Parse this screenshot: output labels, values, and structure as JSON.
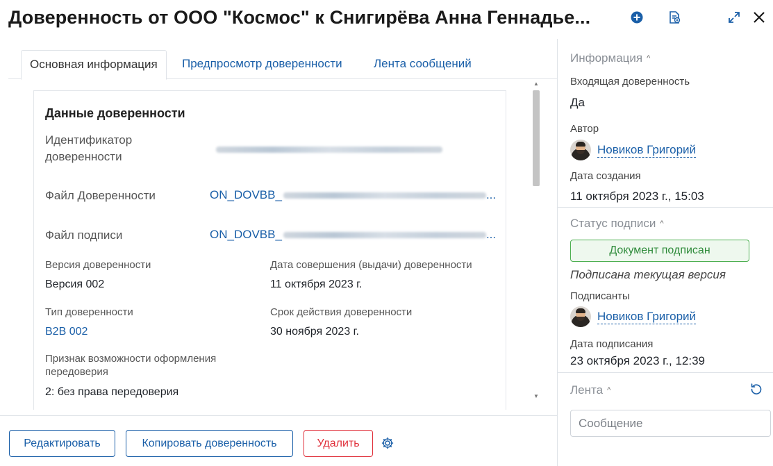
{
  "header": {
    "title": "Доверенность от ООО \"Космос\" к Снигирёва Анна Геннадье...",
    "icons": [
      "plus-circle-icon",
      "document-sign-icon",
      "expand-icon",
      "close-icon"
    ]
  },
  "tabs": [
    {
      "label": "Основная информация",
      "active": true
    },
    {
      "label": "Предпросмотр доверенности",
      "active": false
    },
    {
      "label": "Лента сообщений",
      "active": false
    }
  ],
  "content": {
    "section_title": "Данные доверенности",
    "identifier_label": "Идентификатор\nдоверенности",
    "file_label": "Файл Доверенности",
    "file_value": "ON_DOVBB_",
    "file_ellipsis": "...",
    "sign_file_label": "Файл подписи",
    "sign_file_value": "ON_DOVBB_",
    "sign_file_ellipsis": "...",
    "version_label": "Версия доверенности",
    "version_value": "Версия 002",
    "issue_date_label": "Дата совершения (выдачи) доверенности",
    "issue_date_value": "11 октября 2023 г.",
    "type_label": "Тип доверенности",
    "type_value": "B2B 002",
    "expiry_label": "Срок действия доверенности",
    "expiry_value": "30 ноября 2023 г.",
    "redelegation_label": "Признак возможности оформления передоверия",
    "redelegation_value": "2: без права передоверия"
  },
  "footer": {
    "edit_label": "Редактировать",
    "copy_label": "Копировать доверенность",
    "delete_label": "Удалить"
  },
  "right_panel": {
    "info_header": "Информация",
    "incoming_label": "Входящая доверенность",
    "incoming_value": "Да",
    "author_label": "Автор",
    "author_name": "Новиков Григорий",
    "created_label": "Дата создания",
    "created_value": "11 октября 2023 г., 15:03",
    "sign_status_header": "Статус подписи",
    "sign_badge": "Документ подписан",
    "sign_note": "Подписана текущая версия",
    "signers_label": "Подписанты",
    "signer_name": "Новиков Григорий",
    "sign_date_label": "Дата подписания",
    "sign_date_value": "23 октября 2023 г., 12:39",
    "feed_header": "Лента",
    "message_placeholder": "Сообщение"
  },
  "colors": {
    "accent": "#1a5fa8",
    "danger": "#e0303b",
    "success": "#2e8b3a",
    "border": "#dfe3e8"
  }
}
